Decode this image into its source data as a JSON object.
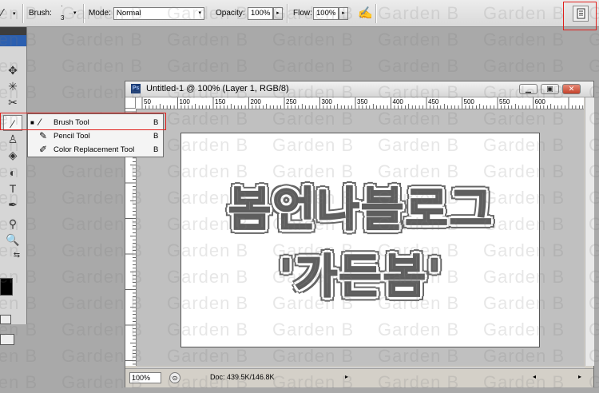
{
  "options_bar": {
    "brush_label": "Brush:",
    "brush_size": "3",
    "mode_label": "Mode:",
    "mode_value": "Normal",
    "opacity_label": "Opacity:",
    "opacity_value": "100%",
    "flow_label": "Flow:",
    "flow_value": "100%"
  },
  "document": {
    "title": "Untitled-1 @ 100% (Layer 1, RGB/8)",
    "zoom": "100%",
    "doc_size": "Doc: 439.5K/146.8K",
    "ruler_marks": [
      "50",
      "100",
      "150",
      "200",
      "250",
      "300",
      "350",
      "400",
      "450",
      "500",
      "550",
      "600"
    ],
    "canvas_text_line1": "봄언나블로그",
    "canvas_text_line2": "'가든봄'"
  },
  "flyout_menu": {
    "items": [
      {
        "label": "Brush Tool",
        "shortcut": "B",
        "active": true
      },
      {
        "label": "Pencil Tool",
        "shortcut": "B",
        "active": false
      },
      {
        "label": "Color Replacement Tool",
        "shortcut": "B",
        "active": false
      }
    ]
  },
  "watermark": "Garden B",
  "colors": {
    "highlight": "#e0201c",
    "toolbox_header": "#2b5fb0",
    "text_fill": "#6f6f6f"
  }
}
